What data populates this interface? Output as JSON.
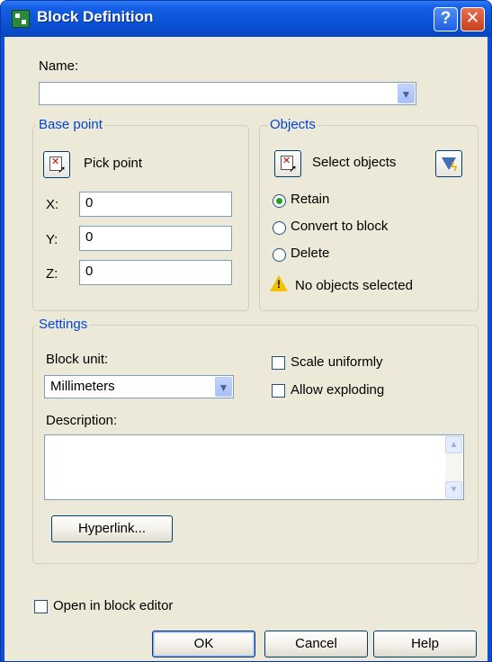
{
  "window": {
    "title": "Block Definition",
    "help_glyph": "?",
    "close_glyph": "✕"
  },
  "name": {
    "label": "Name:",
    "value": ""
  },
  "base_point": {
    "label": "Base point",
    "pick_label": "Pick point",
    "x_label": "X:",
    "x_value": "0",
    "y_label": "Y:",
    "y_value": "0",
    "z_label": "Z:",
    "z_value": "0"
  },
  "objects": {
    "label": "Objects",
    "select_label": "Select objects",
    "options": [
      "Retain",
      "Convert to block",
      "Delete"
    ],
    "selected_option": "Retain",
    "status": "No objects selected"
  },
  "settings": {
    "label": "Settings",
    "block_unit_label": "Block unit:",
    "block_unit_value": "Millimeters",
    "scale_uniformly_label": "Scale uniformly",
    "scale_uniformly_checked": false,
    "allow_exploding_label": "Allow exploding",
    "allow_exploding_checked": false,
    "description_label": "Description:",
    "description_value": "",
    "hyperlink_label": "Hyperlink..."
  },
  "open_in_editor": {
    "label": "Open in block editor",
    "checked": false
  },
  "buttons": {
    "ok": "OK",
    "cancel": "Cancel",
    "help": "Help"
  }
}
